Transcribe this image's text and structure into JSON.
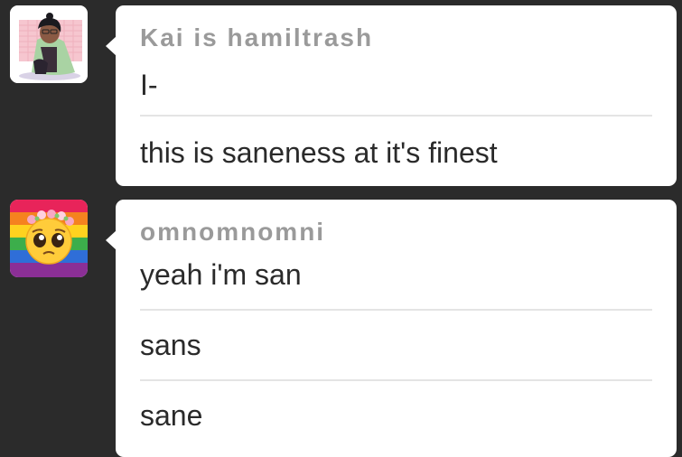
{
  "messages": [
    {
      "user": "Kai is hamiltrash",
      "avatar_icon": "anime-character-avatar",
      "lines": [
        "I-",
        "this is saneness at it's finest"
      ]
    },
    {
      "user": "omnomnomni",
      "avatar_icon": "pleading-face-flower-crown-rainbow-avatar",
      "lines": [
        "yeah i'm san",
        "sans",
        "sane"
      ]
    }
  ],
  "colors": {
    "background": "#2b2b2b",
    "bubble": "#ffffff",
    "username": "#9a9a9a",
    "text": "#2a2a2a",
    "divider": "#e4e4e4"
  }
}
